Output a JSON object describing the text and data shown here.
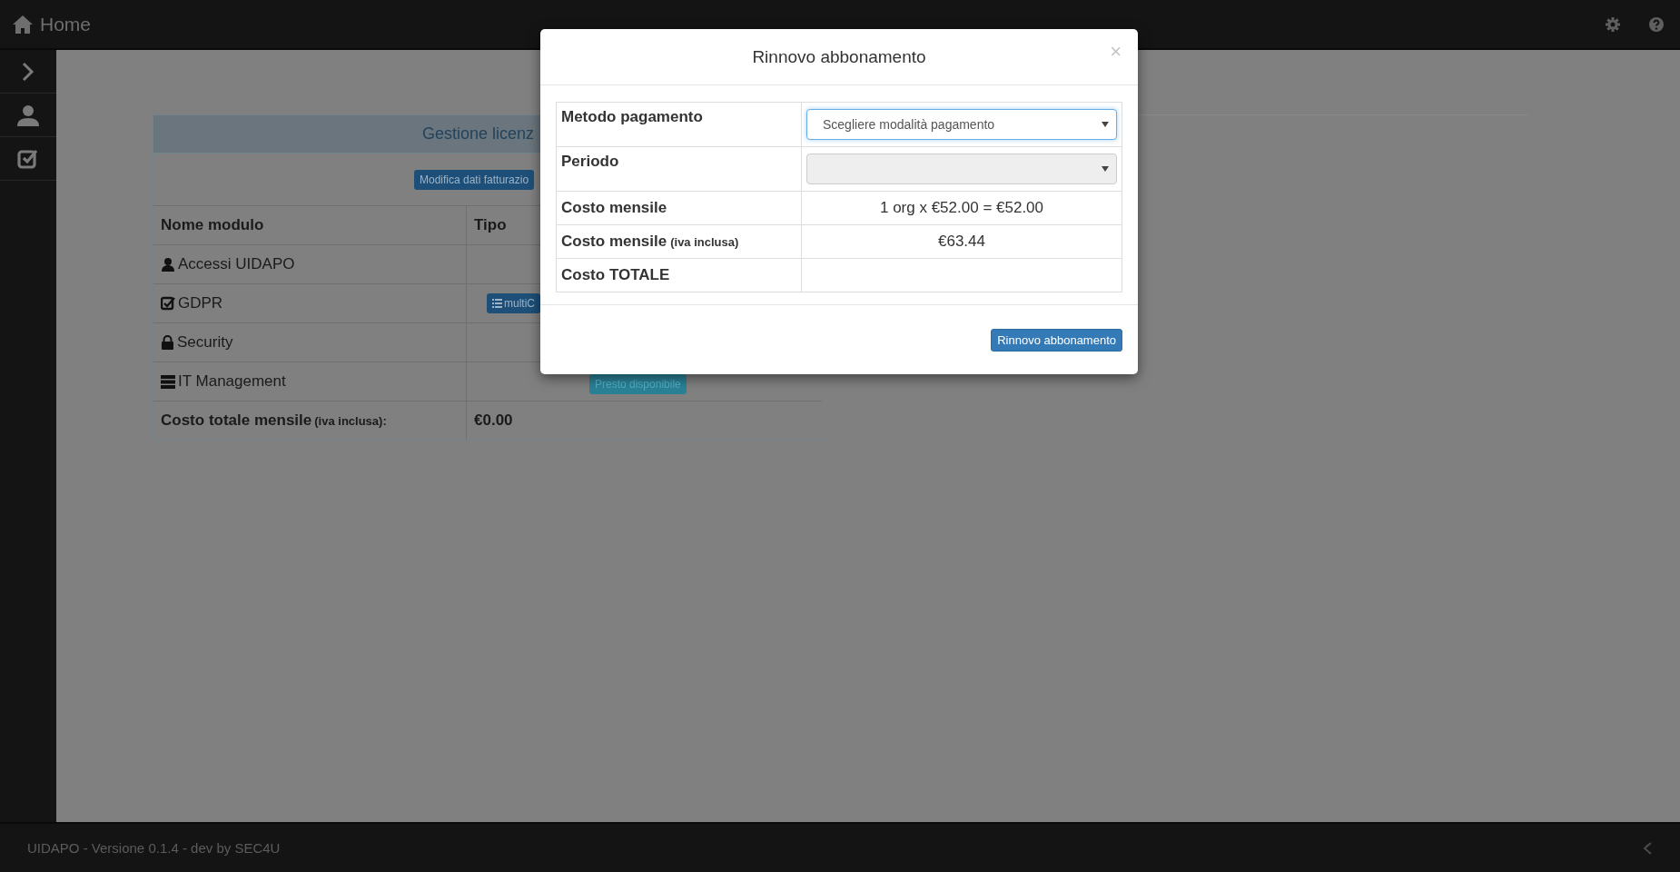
{
  "topbar": {
    "title": "Home"
  },
  "license_card": {
    "title": "Gestione licenz",
    "edit_button": "Modifica dati fatturazio",
    "columns": [
      "Nome modulo",
      "Tipo"
    ],
    "rows": [
      {
        "name": "Accessi UIDAPO"
      },
      {
        "name": "GDPR",
        "badge": {
          "text": "multiC",
          "color": "#1d4f78"
        }
      },
      {
        "name": "Security"
      },
      {
        "name": "IT Management",
        "badge": {
          "text": "Presto disponibile",
          "color": "#2a8196"
        }
      }
    ],
    "total": {
      "label": "Costo totale mensile",
      "note": "(iva inclusa):",
      "value": "€0.00"
    }
  },
  "modal": {
    "title": "Rinnovo abbonamento",
    "close": "×",
    "rows": [
      {
        "label": "Metodo pagamento",
        "kind": "select",
        "value": "Scegliere modalità pagamento",
        "focused": true,
        "disabled": false
      },
      {
        "label": "Periodo",
        "kind": "select",
        "focused": false,
        "disabled": true
      },
      {
        "label": "Costo mensile",
        "kind": "text",
        "value": "1 org x €52.00 = €52.00"
      },
      {
        "label": "Costo mensile",
        "note": "(iva inclusa)",
        "kind": "text",
        "value": "€63.44"
      },
      {
        "label": "Costo TOTALE",
        "kind": "text"
      }
    ],
    "button": "Rinnovo abbonamento"
  },
  "footer": {
    "text": "UIDAPO - Versione 0.1.4 - dev by SEC4U"
  }
}
